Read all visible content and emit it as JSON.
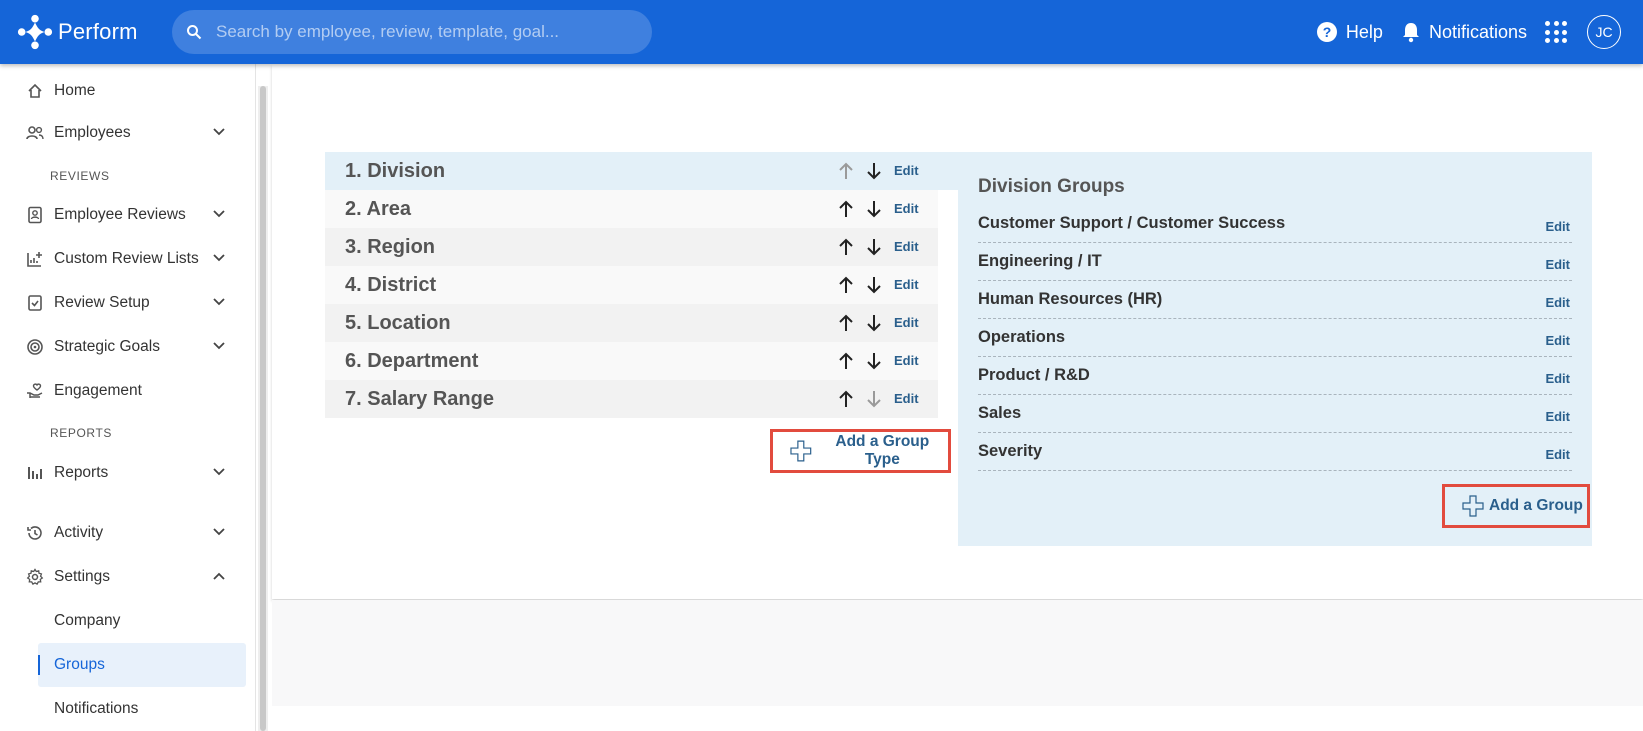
{
  "app": {
    "name": "Perform",
    "user_initials": "JC"
  },
  "search": {
    "placeholder": "Search by employee, review, template, goal..."
  },
  "header": {
    "help_label": "Help",
    "notifications_label": "Notifications"
  },
  "sidebar": {
    "items": [
      {
        "label": "Home",
        "icon": "home-icon"
      },
      {
        "label": "Employees",
        "icon": "people-icon",
        "expandable": true
      },
      {
        "section": "REVIEWS"
      },
      {
        "label": "Employee Reviews",
        "icon": "review-badge-icon",
        "expandable": true
      },
      {
        "label": "Custom Review Lists",
        "icon": "chart-plus-icon",
        "expandable": true
      },
      {
        "label": "Review Setup",
        "icon": "checklist-icon",
        "expandable": true
      },
      {
        "label": "Strategic Goals",
        "icon": "target-icon",
        "expandable": true
      },
      {
        "label": "Engagement",
        "icon": "hand-heart-icon"
      },
      {
        "section": "REPORTS"
      },
      {
        "label": "Reports",
        "icon": "bar-chart-icon",
        "expandable": true
      },
      {
        "label": "Activity",
        "icon": "history-icon",
        "expandable": true
      },
      {
        "label": "Settings",
        "icon": "gear-icon",
        "expanded": true
      },
      {
        "label": "Company",
        "sub": true
      },
      {
        "label": "Groups",
        "sub": true,
        "active": true
      },
      {
        "label": "Notifications",
        "sub": true
      }
    ]
  },
  "group_types": [
    {
      "label": "1. Division",
      "up_enabled": false,
      "down_enabled": true,
      "edit": "Edit"
    },
    {
      "label": "2. Area",
      "up_enabled": true,
      "down_enabled": true,
      "edit": "Edit"
    },
    {
      "label": "3. Region",
      "up_enabled": true,
      "down_enabled": true,
      "edit": "Edit"
    },
    {
      "label": "4. District",
      "up_enabled": true,
      "down_enabled": true,
      "edit": "Edit"
    },
    {
      "label": "5. Location",
      "up_enabled": true,
      "down_enabled": true,
      "edit": "Edit"
    },
    {
      "label": "6. Department",
      "up_enabled": true,
      "down_enabled": true,
      "edit": "Edit"
    },
    {
      "label": "7. Salary Range",
      "up_enabled": true,
      "down_enabled": false,
      "edit": "Edit"
    }
  ],
  "add_group_type_label": "Add a Group Type",
  "groups_panel": {
    "title": "Division Groups",
    "groups": [
      {
        "name": "Customer Support / Customer Success",
        "edit": "Edit"
      },
      {
        "name": "Engineering / IT",
        "edit": "Edit"
      },
      {
        "name": "Human Resources (HR)",
        "edit": "Edit"
      },
      {
        "name": "Operations",
        "edit": "Edit"
      },
      {
        "name": "Product / R&D",
        "edit": "Edit"
      },
      {
        "name": "Sales",
        "edit": "Edit"
      },
      {
        "name": "Severity",
        "edit": "Edit"
      }
    ],
    "add_group_label": "Add a Group"
  },
  "colors": {
    "brand": "#1565d8",
    "highlight": "#e24b3e",
    "panel": "#e3f0f8"
  }
}
